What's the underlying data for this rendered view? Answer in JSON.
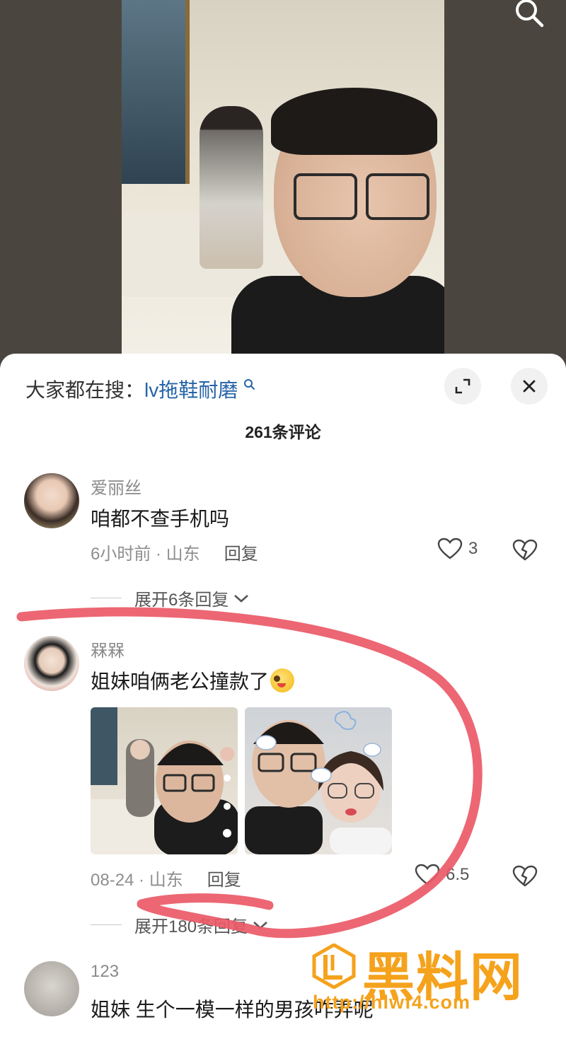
{
  "header": {
    "search_hint_prefix": "大家都在搜：",
    "search_hint_keyword": "lv拖鞋耐磨",
    "comment_count": "261条评论"
  },
  "comments": [
    {
      "username": "爱丽丝",
      "text": "咱都不查手机吗",
      "time": "6小时前 · 山东",
      "reply_label": "回复",
      "likes": "3",
      "expand_label": "展开6条回复"
    },
    {
      "username": "槑槑",
      "text": "姐妹咱俩老公撞款了",
      "time": "08-24 · 山东",
      "reply_label": "回复",
      "likes": "6.5",
      "expand_label": "展开180条回复"
    },
    {
      "username": "123",
      "text": "姐妹 生个一模一样的男孩咋弄呢"
    }
  ],
  "watermark": {
    "title": "黑料网",
    "url": "http://hlwf4.com"
  },
  "colors": {
    "accent_link": "#2563a8",
    "annotation_red": "#ea5a67",
    "watermark_orange": "#f5a21c"
  }
}
